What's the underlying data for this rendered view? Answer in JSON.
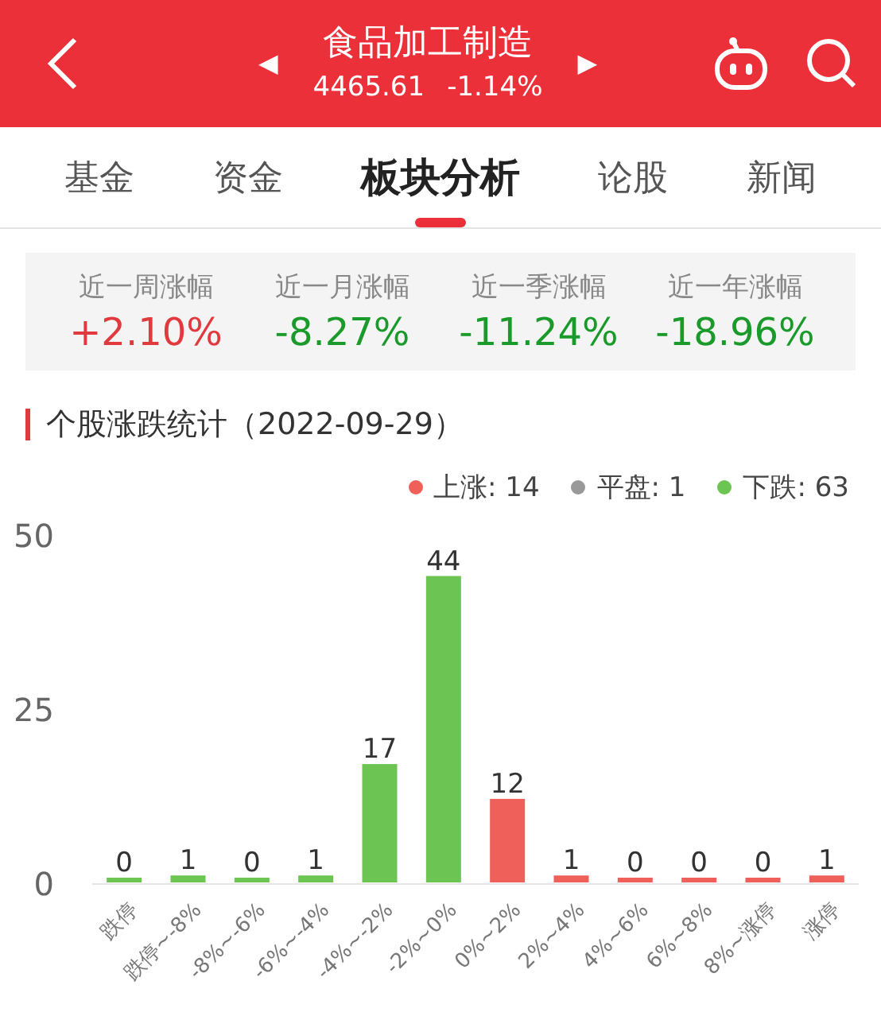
{
  "header": {
    "title": "食品加工制造",
    "price": "4465.61",
    "change": "-1.14%",
    "prev_arrow": "◀",
    "next_arrow": "▶"
  },
  "tabs": [
    {
      "label": "基金",
      "selected": false
    },
    {
      "label": "资金",
      "selected": false
    },
    {
      "label": "板块分析",
      "selected": true
    },
    {
      "label": "论股",
      "selected": false
    },
    {
      "label": "新闻",
      "selected": false
    }
  ],
  "stats": [
    {
      "label": "近一周涨幅",
      "value": "+2.10%",
      "color": "#e0393e"
    },
    {
      "label": "近一月涨幅",
      "value": "-8.27%",
      "color": "#1a9a2a"
    },
    {
      "label": "近一季涨幅",
      "value": "-11.24%",
      "color": "#1a9a2a"
    },
    {
      "label": "近一年涨幅",
      "value": "-18.96%",
      "color": "#1a9a2a"
    }
  ],
  "section_title": "个股涨跌统计（2022-09-29）",
  "legend": [
    {
      "label": "上涨: 14",
      "color": "#f0605a"
    },
    {
      "label": "平盘: 1",
      "color": "#999999"
    },
    {
      "label": "下跌: 63",
      "color": "#6cc552"
    }
  ],
  "chart_data": {
    "type": "bar",
    "categories": [
      "跌停",
      "跌停~-8%",
      "-8%~-6%",
      "-6%~-4%",
      "-4%~-2%",
      "-2%~0%",
      "0%~2%",
      "2%~4%",
      "4%~6%",
      "6%~8%",
      "8%~涨停",
      "涨停"
    ],
    "series": [
      {
        "color": "#6cc552",
        "values": [
          0,
          1,
          0,
          1,
          17,
          44,
          null,
          null,
          null,
          null,
          null,
          null
        ]
      },
      {
        "color": "#f0605a",
        "values": [
          null,
          null,
          null,
          null,
          null,
          null,
          12,
          1,
          0,
          0,
          0,
          1
        ]
      }
    ],
    "stacked": true,
    "ylim": [
      0,
      50
    ],
    "yticks": [
      0,
      25,
      50
    ],
    "data_labels": true
  }
}
